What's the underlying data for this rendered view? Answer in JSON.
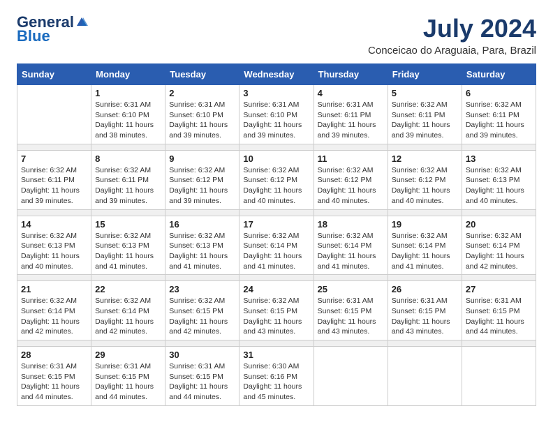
{
  "logo": {
    "general": "General",
    "blue": "Blue"
  },
  "title": "July 2024",
  "subtitle": "Conceicao do Araguaia, Para, Brazil",
  "days_of_week": [
    "Sunday",
    "Monday",
    "Tuesday",
    "Wednesday",
    "Thursday",
    "Friday",
    "Saturday"
  ],
  "weeks": [
    [
      {
        "day": "",
        "sunrise": "",
        "sunset": "",
        "daylight": ""
      },
      {
        "day": "1",
        "sunrise": "Sunrise: 6:31 AM",
        "sunset": "Sunset: 6:10 PM",
        "daylight": "Daylight: 11 hours and 38 minutes."
      },
      {
        "day": "2",
        "sunrise": "Sunrise: 6:31 AM",
        "sunset": "Sunset: 6:10 PM",
        "daylight": "Daylight: 11 hours and 39 minutes."
      },
      {
        "day": "3",
        "sunrise": "Sunrise: 6:31 AM",
        "sunset": "Sunset: 6:10 PM",
        "daylight": "Daylight: 11 hours and 39 minutes."
      },
      {
        "day": "4",
        "sunrise": "Sunrise: 6:31 AM",
        "sunset": "Sunset: 6:11 PM",
        "daylight": "Daylight: 11 hours and 39 minutes."
      },
      {
        "day": "5",
        "sunrise": "Sunrise: 6:32 AM",
        "sunset": "Sunset: 6:11 PM",
        "daylight": "Daylight: 11 hours and 39 minutes."
      },
      {
        "day": "6",
        "sunrise": "Sunrise: 6:32 AM",
        "sunset": "Sunset: 6:11 PM",
        "daylight": "Daylight: 11 hours and 39 minutes."
      }
    ],
    [
      {
        "day": "7",
        "sunrise": "Sunrise: 6:32 AM",
        "sunset": "Sunset: 6:11 PM",
        "daylight": "Daylight: 11 hours and 39 minutes."
      },
      {
        "day": "8",
        "sunrise": "Sunrise: 6:32 AM",
        "sunset": "Sunset: 6:11 PM",
        "daylight": "Daylight: 11 hours and 39 minutes."
      },
      {
        "day": "9",
        "sunrise": "Sunrise: 6:32 AM",
        "sunset": "Sunset: 6:12 PM",
        "daylight": "Daylight: 11 hours and 39 minutes."
      },
      {
        "day": "10",
        "sunrise": "Sunrise: 6:32 AM",
        "sunset": "Sunset: 6:12 PM",
        "daylight": "Daylight: 11 hours and 40 minutes."
      },
      {
        "day": "11",
        "sunrise": "Sunrise: 6:32 AM",
        "sunset": "Sunset: 6:12 PM",
        "daylight": "Daylight: 11 hours and 40 minutes."
      },
      {
        "day": "12",
        "sunrise": "Sunrise: 6:32 AM",
        "sunset": "Sunset: 6:12 PM",
        "daylight": "Daylight: 11 hours and 40 minutes."
      },
      {
        "day": "13",
        "sunrise": "Sunrise: 6:32 AM",
        "sunset": "Sunset: 6:13 PM",
        "daylight": "Daylight: 11 hours and 40 minutes."
      }
    ],
    [
      {
        "day": "14",
        "sunrise": "Sunrise: 6:32 AM",
        "sunset": "Sunset: 6:13 PM",
        "daylight": "Daylight: 11 hours and 40 minutes."
      },
      {
        "day": "15",
        "sunrise": "Sunrise: 6:32 AM",
        "sunset": "Sunset: 6:13 PM",
        "daylight": "Daylight: 11 hours and 41 minutes."
      },
      {
        "day": "16",
        "sunrise": "Sunrise: 6:32 AM",
        "sunset": "Sunset: 6:13 PM",
        "daylight": "Daylight: 11 hours and 41 minutes."
      },
      {
        "day": "17",
        "sunrise": "Sunrise: 6:32 AM",
        "sunset": "Sunset: 6:14 PM",
        "daylight": "Daylight: 11 hours and 41 minutes."
      },
      {
        "day": "18",
        "sunrise": "Sunrise: 6:32 AM",
        "sunset": "Sunset: 6:14 PM",
        "daylight": "Daylight: 11 hours and 41 minutes."
      },
      {
        "day": "19",
        "sunrise": "Sunrise: 6:32 AM",
        "sunset": "Sunset: 6:14 PM",
        "daylight": "Daylight: 11 hours and 41 minutes."
      },
      {
        "day": "20",
        "sunrise": "Sunrise: 6:32 AM",
        "sunset": "Sunset: 6:14 PM",
        "daylight": "Daylight: 11 hours and 42 minutes."
      }
    ],
    [
      {
        "day": "21",
        "sunrise": "Sunrise: 6:32 AM",
        "sunset": "Sunset: 6:14 PM",
        "daylight": "Daylight: 11 hours and 42 minutes."
      },
      {
        "day": "22",
        "sunrise": "Sunrise: 6:32 AM",
        "sunset": "Sunset: 6:14 PM",
        "daylight": "Daylight: 11 hours and 42 minutes."
      },
      {
        "day": "23",
        "sunrise": "Sunrise: 6:32 AM",
        "sunset": "Sunset: 6:15 PM",
        "daylight": "Daylight: 11 hours and 42 minutes."
      },
      {
        "day": "24",
        "sunrise": "Sunrise: 6:32 AM",
        "sunset": "Sunset: 6:15 PM",
        "daylight": "Daylight: 11 hours and 43 minutes."
      },
      {
        "day": "25",
        "sunrise": "Sunrise: 6:31 AM",
        "sunset": "Sunset: 6:15 PM",
        "daylight": "Daylight: 11 hours and 43 minutes."
      },
      {
        "day": "26",
        "sunrise": "Sunrise: 6:31 AM",
        "sunset": "Sunset: 6:15 PM",
        "daylight": "Daylight: 11 hours and 43 minutes."
      },
      {
        "day": "27",
        "sunrise": "Sunrise: 6:31 AM",
        "sunset": "Sunset: 6:15 PM",
        "daylight": "Daylight: 11 hours and 44 minutes."
      }
    ],
    [
      {
        "day": "28",
        "sunrise": "Sunrise: 6:31 AM",
        "sunset": "Sunset: 6:15 PM",
        "daylight": "Daylight: 11 hours and 44 minutes."
      },
      {
        "day": "29",
        "sunrise": "Sunrise: 6:31 AM",
        "sunset": "Sunset: 6:15 PM",
        "daylight": "Daylight: 11 hours and 44 minutes."
      },
      {
        "day": "30",
        "sunrise": "Sunrise: 6:31 AM",
        "sunset": "Sunset: 6:15 PM",
        "daylight": "Daylight: 11 hours and 44 minutes."
      },
      {
        "day": "31",
        "sunrise": "Sunrise: 6:30 AM",
        "sunset": "Sunset: 6:16 PM",
        "daylight": "Daylight: 11 hours and 45 minutes."
      },
      {
        "day": "",
        "sunrise": "",
        "sunset": "",
        "daylight": ""
      },
      {
        "day": "",
        "sunrise": "",
        "sunset": "",
        "daylight": ""
      },
      {
        "day": "",
        "sunrise": "",
        "sunset": "",
        "daylight": ""
      }
    ]
  ]
}
